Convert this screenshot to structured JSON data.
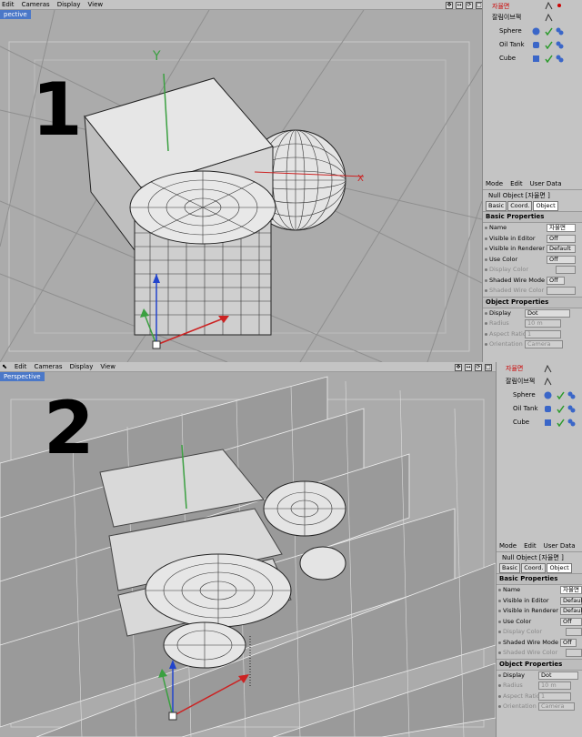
{
  "panel1": {
    "menu": [
      "Edit",
      "Cameras",
      "Display",
      "View"
    ],
    "viewport_tab": "pective",
    "label": "1",
    "objects": [
      {
        "name": "자율면",
        "highlight": true,
        "icon": "null-object-icon"
      },
      {
        "name": "잘림이브젝",
        "highlight": false,
        "icon": "null-object-icon"
      },
      {
        "name": "Sphere",
        "highlight": false,
        "icon": "sphere-icon"
      },
      {
        "name": "Oil Tank",
        "highlight": false,
        "icon": "oiltank-icon"
      },
      {
        "name": "Cube",
        "highlight": false,
        "icon": "cube-icon"
      }
    ],
    "attr": {
      "menu": [
        "Mode",
        "Edit",
        "User Data"
      ],
      "title": "Null Object [자율면 ]",
      "tabs": [
        "Basic",
        "Coord.",
        "Object"
      ],
      "basic_header": "Basic Properties",
      "basic_rows": [
        {
          "label": "Name",
          "value": "자율면",
          "dim": false
        },
        {
          "label": "Visible in Editor",
          "value": "Off",
          "dim": false
        },
        {
          "label": "Visible in Renderer",
          "value": "Default",
          "dim": false
        },
        {
          "label": "Use Color",
          "value": "Off",
          "dim": false
        },
        {
          "label": "Display Color",
          "value": "",
          "dim": true
        },
        {
          "label": "Shaded Wire Mode",
          "value": "Off",
          "dim": false
        },
        {
          "label": "Shaded Wire Color",
          "value": "",
          "dim": true
        }
      ],
      "object_header": "Object Properties",
      "object_rows": [
        {
          "label": "Display",
          "value": "Dot",
          "dim": false
        },
        {
          "label": "Radius",
          "value": "10 m",
          "dim": true
        },
        {
          "label": "Aspect Ratio",
          "value": "1",
          "dim": true
        },
        {
          "label": "Orientation",
          "value": "Camera",
          "dim": true
        }
      ]
    }
  },
  "panel2": {
    "menu": [
      "Edit",
      "Cameras",
      "Display",
      "View"
    ],
    "viewport_tab": "Perspective",
    "label": "2",
    "objects": [
      {
        "name": "자율면",
        "highlight": true,
        "icon": "null-object-icon"
      },
      {
        "name": "잘림이브젝",
        "highlight": false,
        "icon": "null-object-icon"
      },
      {
        "name": "Sphere",
        "highlight": false,
        "icon": "sphere-icon"
      },
      {
        "name": "Oil Tank",
        "highlight": false,
        "icon": "oiltank-icon"
      },
      {
        "name": "Cube",
        "highlight": false,
        "icon": "cube-icon"
      }
    ],
    "attr": {
      "menu": [
        "Mode",
        "Edit",
        "User Data"
      ],
      "title": "Null Object [자율면 ]",
      "tabs": [
        "Basic",
        "Coord.",
        "Object"
      ],
      "basic_header": "Basic Properties",
      "basic_rows": [
        {
          "label": "Name",
          "value": "자율면",
          "dim": false
        },
        {
          "label": "Visible in Editor",
          "value": "Default",
          "dim": false
        },
        {
          "label": "Visible in Renderer",
          "value": "Default",
          "dim": false
        },
        {
          "label": "Use Color",
          "value": "Off",
          "dim": false
        },
        {
          "label": "Display Color",
          "value": "",
          "dim": true
        },
        {
          "label": "Shaded Wire Mode",
          "value": "Off",
          "dim": false
        },
        {
          "label": "Shaded Wire Color",
          "value": "",
          "dim": true
        }
      ],
      "object_header": "Object Properties",
      "object_rows": [
        {
          "label": "Display",
          "value": "Dot",
          "dim": false
        },
        {
          "label": "Radius",
          "value": "10 m",
          "dim": true
        },
        {
          "label": "Aspect Ratio",
          "value": "1",
          "dim": true
        },
        {
          "label": "Orientation",
          "value": "Camera",
          "dim": true
        }
      ]
    }
  },
  "colors": {
    "viewport_bg": "#ababab",
    "ui_bg": "#c4c4c4",
    "tab_blue": "#4b78c8",
    "axis_y": "#3aa040",
    "axis_x": "#cc2222",
    "axis_z": "#2244cc",
    "highlight_text": "#cc0000"
  }
}
